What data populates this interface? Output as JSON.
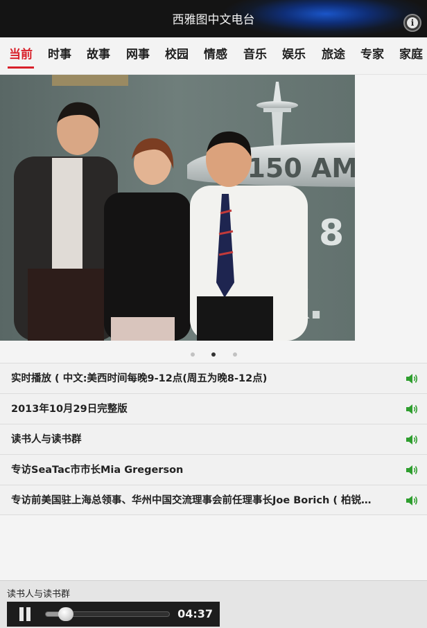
{
  "app": {
    "title": "西雅图中文电台"
  },
  "tabs": [
    {
      "label": "当前",
      "active": true
    },
    {
      "label": "时事",
      "active": false
    },
    {
      "label": "故事",
      "active": false
    },
    {
      "label": "网事",
      "active": false
    },
    {
      "label": "校园",
      "active": false
    },
    {
      "label": "情感",
      "active": false
    },
    {
      "label": "音乐",
      "active": false
    },
    {
      "label": "娱乐",
      "active": false
    },
    {
      "label": "旅途",
      "active": false
    },
    {
      "label": "专家",
      "active": false
    },
    {
      "label": "家庭",
      "active": false
    }
  ],
  "carousel": {
    "sign_text": "1150 AM",
    "sign_digit": "8",
    "sign_letters": "K.",
    "page_count": 3,
    "active_page": 2
  },
  "programs": [
    {
      "label": "实时播放 ( 中文:美西时间每晚9-12点(周五为晚8-12点)",
      "icon": "speaker-icon"
    },
    {
      "label": "2013年10月29日完整版",
      "icon": "speaker-icon"
    },
    {
      "label": "读书人与读书群",
      "icon": "speaker-icon"
    },
    {
      "label": "专访SeaTac市市长Mia Gregerson",
      "icon": "speaker-icon"
    },
    {
      "label": "专访前美国驻上海总领事、华州中国交流理事会前任理事长Joe Borich ( 柏锐…",
      "icon": "speaker-icon"
    }
  ],
  "player": {
    "now_playing": "读书人与读书群",
    "time": "04:37",
    "progress": 0.12,
    "state": "playing"
  },
  "colors": {
    "accent": "#d8202a",
    "speaker": "#2f9e2f",
    "titlebar_glow": "#1a55c8"
  }
}
